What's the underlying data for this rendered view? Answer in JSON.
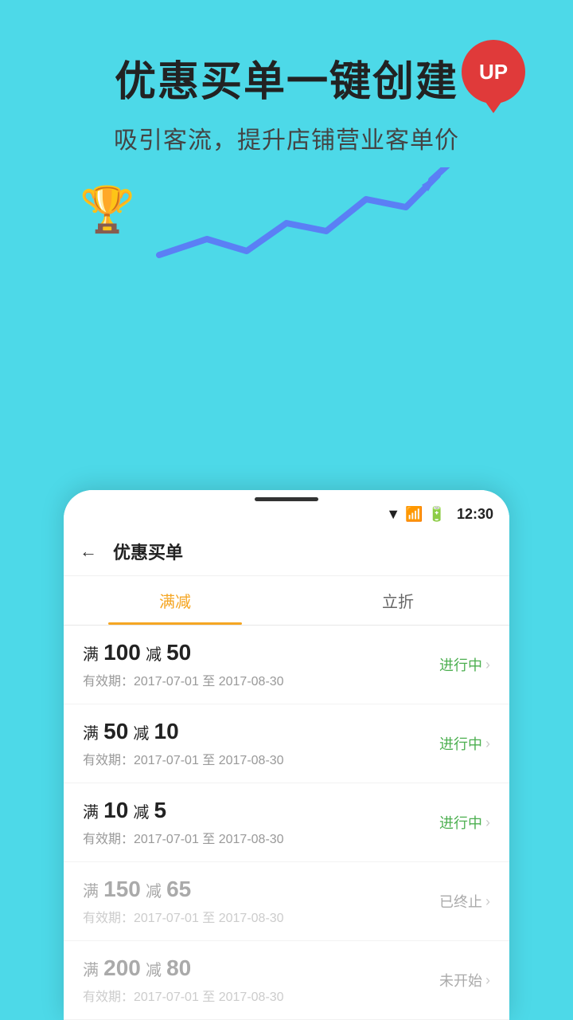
{
  "hero": {
    "title": "优惠买单一键创建",
    "subtitle": "吸引客流，提升店铺营业客单价",
    "up_label": "UP"
  },
  "status_bar": {
    "time": "12:30"
  },
  "app": {
    "title": "优惠买单",
    "back_label": "←"
  },
  "tabs": [
    {
      "label": "满减",
      "active": true
    },
    {
      "label": "立折",
      "active": false
    }
  ],
  "items": [
    {
      "prefix": "满",
      "amount1": "100",
      "mid": "减",
      "amount2": "50",
      "date": "有效期：2017-07-01 至 2017-08-30",
      "status": "进行中",
      "status_type": "active",
      "disabled": false
    },
    {
      "prefix": "满",
      "amount1": "50",
      "mid": "减",
      "amount2": "10",
      "date": "有效期：2017-07-01 至 2017-08-30",
      "status": "进行中",
      "status_type": "active",
      "disabled": false
    },
    {
      "prefix": "满",
      "amount1": "10",
      "mid": "减",
      "amount2": "5",
      "date": "有效期：2017-07-01 至 2017-08-30",
      "status": "进行中",
      "status_type": "active",
      "disabled": false
    },
    {
      "prefix": "满",
      "amount1": "150",
      "mid": "减",
      "amount2": "65",
      "date": "有效期：2017-07-01 至 2017-08-30",
      "status": "已终止",
      "status_type": "stopped",
      "disabled": true
    },
    {
      "prefix": "满",
      "amount1": "200",
      "mid": "减",
      "amount2": "80",
      "date": "有效期：2017-07-01 至 2017-08-30",
      "status": "未开始",
      "status_type": "upcoming",
      "disabled": true
    }
  ]
}
